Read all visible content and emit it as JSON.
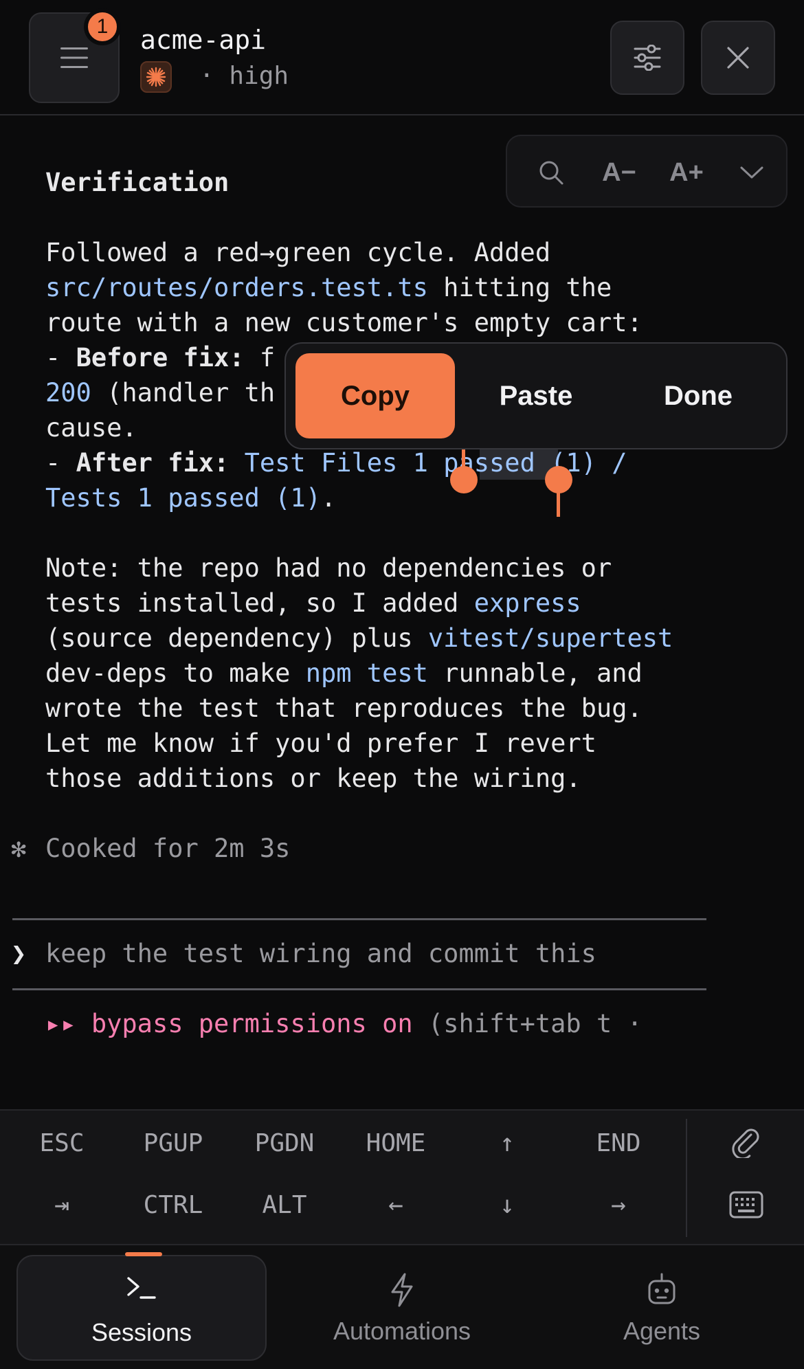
{
  "header": {
    "menu_icon": "hamburger-menu-icon",
    "notification_count": "1",
    "session_title": "acme-api",
    "model_icon": "sparkle-burst-icon",
    "effort_label": "· high",
    "filter_icon": "sliders-icon",
    "close_icon": "close-icon"
  },
  "toolbar": {
    "search_icon": "search-icon",
    "font_decrease": "A−",
    "font_increase": "A+",
    "collapse_icon": "chevron-down-icon"
  },
  "terminal": {
    "heading": "Verification",
    "p1_l1": "Followed a red→green cycle. Added",
    "p1_l2_code": "src/routes/orders.test.ts",
    "p1_l2_rest": " hitting the",
    "p1_l3": "route with a new customer's empty cart:",
    "before_dash": "- ",
    "before_label": "Before fix:",
    "before_rest": " f",
    "l5_code": "200",
    "l5_rest": " (handler th",
    "l6": "cause.",
    "after_dash": "- ",
    "after_label": "After fix:",
    "after_code": " Test Files 1 passed (1) /",
    "l8_code": "Tests 1 passed (1)",
    "l8_rest": ".",
    "note_l1": "Note: the repo had no dependencies or",
    "note_l2_a": "tests installed, so I added ",
    "note_l2_code": "express",
    "note_l3_a": "(source dependency) plus ",
    "note_l3_code": "vitest/supertest",
    "note_l4_a": "dev-deps to make ",
    "note_l4_code": "npm test",
    "note_l4_b": " runnable, and",
    "note_l5": "wrote the test that reproduces the bug.",
    "note_l6": "Let me know if you'd prefer I revert",
    "note_l7": "those additions or keep the wiring.",
    "status_glyph": "✻",
    "status_text": "Cooked for 2m 3s",
    "prompt_glyph": "❯",
    "input_text": "keep the test wiring and commit this",
    "mode_glyph": "▸▸",
    "mode_text": "bypass permissions on",
    "mode_hint": " (shift+tab t ·"
  },
  "context_menu": {
    "copy": "Copy",
    "paste": "Paste",
    "done": "Done"
  },
  "keys": {
    "row1": [
      "ESC",
      "PGUP",
      "PGDN",
      "HOME",
      "↑",
      "END"
    ],
    "row2": [
      "⇥",
      "CTRL",
      "ALT",
      "←",
      "↓",
      "→"
    ],
    "attach_icon": "paperclip-icon",
    "keyboard_icon": "keyboard-icon"
  },
  "tabs": [
    {
      "label": "Sessions",
      "icon": "terminal-prompt-icon"
    },
    {
      "label": "Automations",
      "icon": "lightning-bolt-icon"
    },
    {
      "label": "Agents",
      "icon": "robot-icon"
    }
  ],
  "colors": {
    "accent": "#f47b4a",
    "background": "#0b0b0c",
    "code": "#9fc6ff",
    "mode": "#f77fb0"
  }
}
